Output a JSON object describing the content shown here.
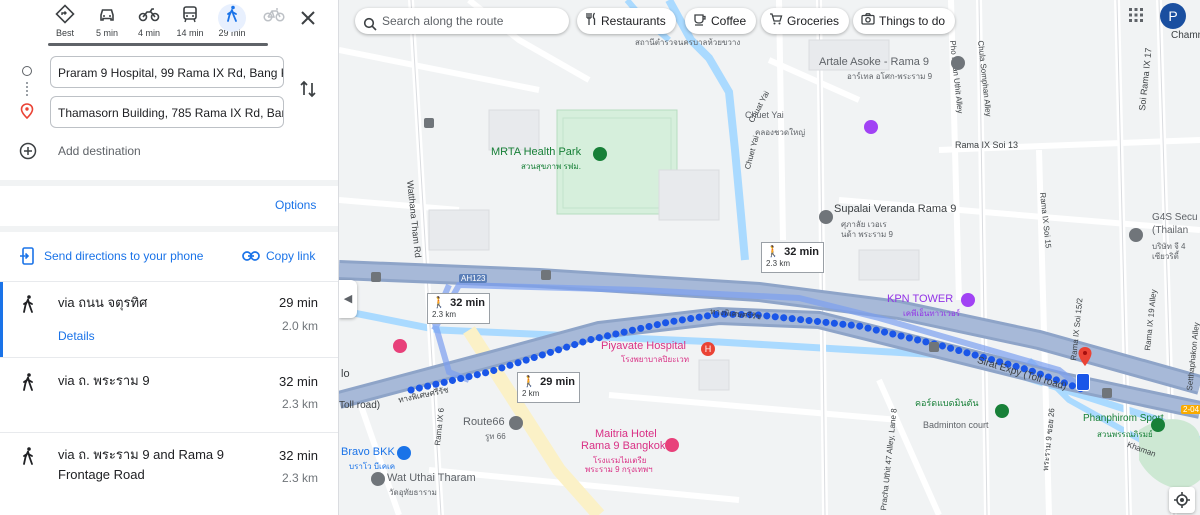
{
  "modes": [
    {
      "label": "Best",
      "icon": "diamond-directions-icon"
    },
    {
      "label": "5 min",
      "icon": "car-icon"
    },
    {
      "label": "4 min",
      "icon": "motorcycle-icon"
    },
    {
      "label": "14 min",
      "icon": "transit-icon"
    },
    {
      "label": "29 min",
      "icon": "walk-icon",
      "active": true
    },
    {
      "label": "",
      "icon": "bicycle-icon"
    }
  ],
  "origin": "Praram 9 Hospital, 99 Rama IX Rd, Bang K",
  "destination": "Thamasorn Building, 785 Rama IX Rd, Ban",
  "add_destination": "Add destination",
  "options": "Options",
  "send_directions": "Send directions to your phone",
  "copy_link": "Copy link",
  "routes": [
    {
      "via": "via ถนน จตุรทิศ",
      "time": "29 min",
      "distance": "2.0 km",
      "details": "Details",
      "selected": true
    },
    {
      "via": "via ถ. พระราม 9",
      "time": "32 min",
      "distance": "2.3 km"
    },
    {
      "via": "via ถ. พระราม 9 and Rama 9 Frontage Road",
      "time": "32 min",
      "distance": "2.3 km"
    }
  ],
  "map": {
    "search_placeholder": "Search along the route",
    "chips": [
      "Restaurants",
      "Coffee",
      "Groceries",
      "Things to do"
    ],
    "avatar_letter": "P",
    "labels": {
      "chamn": "Chamn",
      "top_thai": "สถานีตำรวจนครบาลห้วยขวาง",
      "artale": "Artale Asoke - Rama 9",
      "artale_th": "อาร์เทล อโศก-พระราม 9",
      "mrta": "MRTA Health Park",
      "mrta_th": "สวนสุขภาพ รฟม.",
      "chuet_yai": "Chuet Yai",
      "chuet_yai_th": "คลองชวดใหญ่",
      "chuat_yai_road": "Chuat Yai",
      "watthana": "Watthana Tham Rd",
      "phrom": "Pho Hiran Uthit Alley",
      "chula": "Chula Somphan Alley",
      "soi13": "Rama IX Soi 13",
      "soi15": "Rama IX Soi 15",
      "soi17": "Soi Rama IX 17",
      "soi19": "Rama IX 19 Alley",
      "supalai": "Supalai Veranda Rama 9",
      "supalai_th1": "ศุภาลัย เวอเร",
      "supalai_th2": "นด้า พระราม 9",
      "g4s": "G4S Secu",
      "g4s2": "(Thailan",
      "g4s_th1": "บริษัท จี 4",
      "g4s_th2": "เซียวริตี้",
      "kpn": "KPN TOWER",
      "kpn_th": "เคพีเอ็นทาวเวอร์",
      "piyavate": "Piyavate Hospital",
      "piyavate_th": "โรงพยาบาลปิยะเวท",
      "sirat": "Sirat Expy (Toll road)",
      "sirat_th": "ทางพิเศษศรีรัช",
      "toll_left": "Toll road)",
      "toll_left_th": "ทางพิเศษศรีรัช",
      "route66": "Route66",
      "route66_th": "รูท 66",
      "maitria": "Maitria Hotel",
      "maitria2": "Rama 9 Bangkok",
      "maitria_th1": "โรงแรมไมเตรีย",
      "maitria_th2": "พระราม 9 กรุงเทพฯ",
      "bravo": "Bravo BKK",
      "bravo_th": "บราโว บีเคเค",
      "watuthai": "Wat Uthai Tharam",
      "watuthai_th": "วัดอุทัยธาราม",
      "rama9_6": "Rama IX 6",
      "soi47": "Pracha Uthit 47 Alley, Lane 8",
      "rama9_26": "พระราม 9 ซอย 26",
      "rama9_15_2": "Rama IX Soi 15/2",
      "badminton": "คอร์ดแบดมินตัน",
      "badminton2": "Badminton court",
      "phanphi": "Phanphirom Sport",
      "phanphi_th": "สวนพรรณภิรมย์",
      "khaman": "Khaman",
      "setthaphakon": "Setthaphakon Alley",
      "ah123": "AH123",
      "r24": "2-04",
      "lo": "lo"
    },
    "time_boxes": [
      {
        "time": "32 min",
        "dist": "2.3 km"
      },
      {
        "time": "32 min",
        "dist": "2.3 km"
      },
      {
        "time": "29 min",
        "dist": "2 km"
      }
    ]
  }
}
